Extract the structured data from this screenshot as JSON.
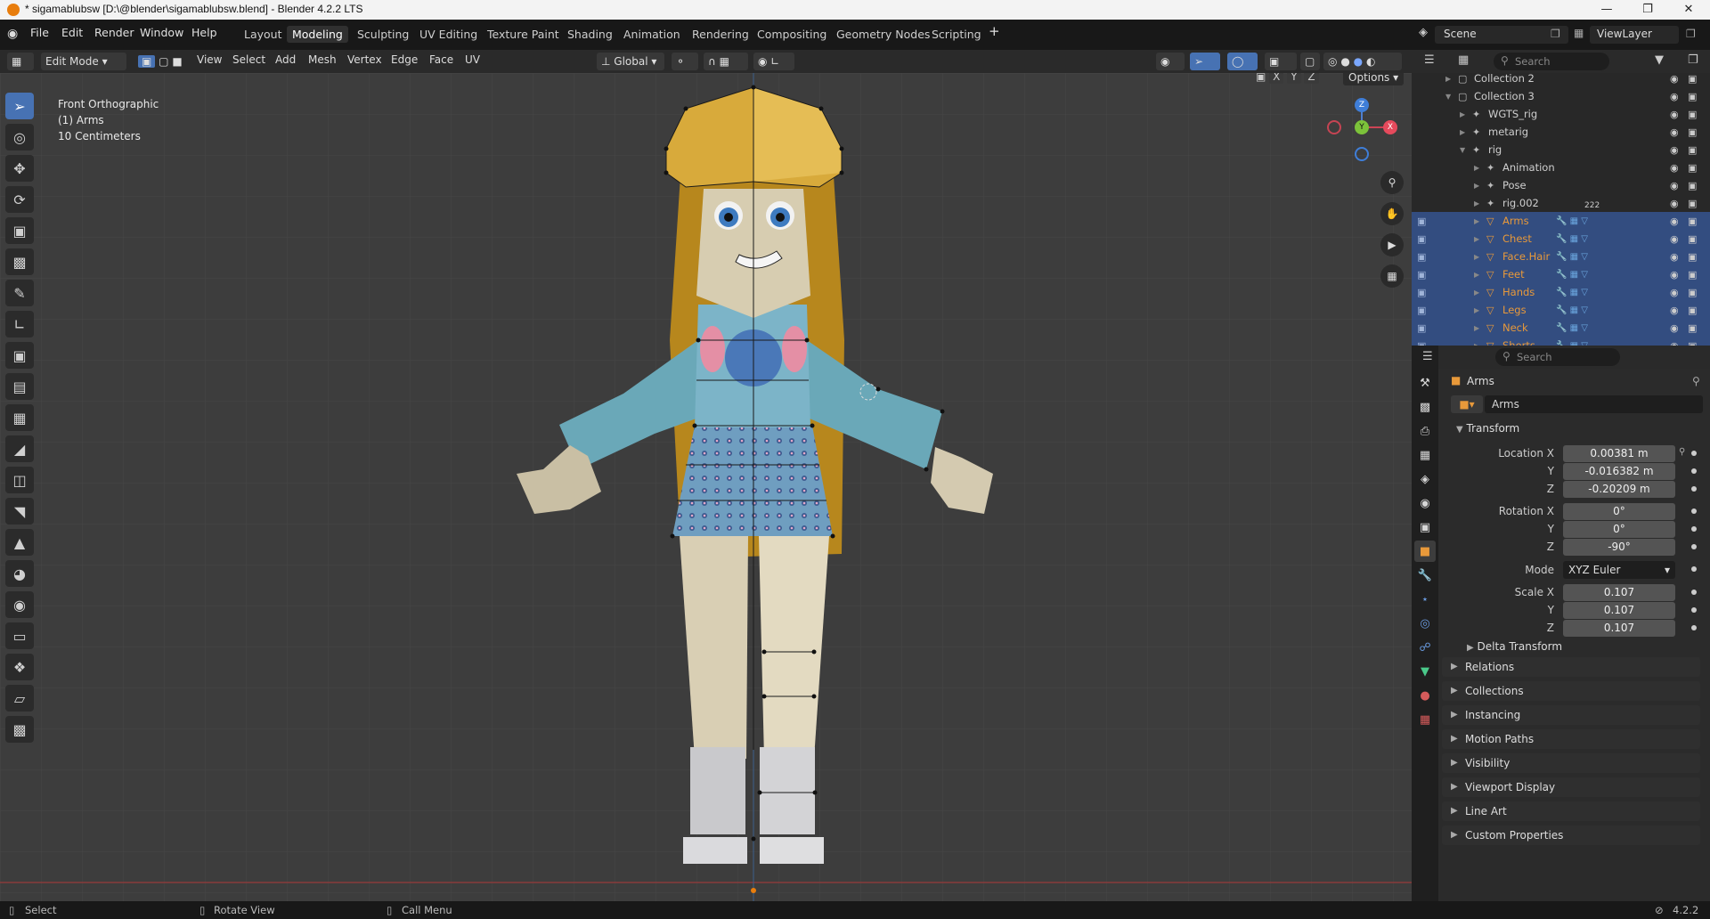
{
  "window": {
    "title": "* sigamablubsw [D:\\@blender\\sigamablubsw.blend] - Blender 4.2.2 LTS"
  },
  "menu": [
    "File",
    "Edit",
    "Render",
    "Window",
    "Help"
  ],
  "workspaces": [
    "Layout",
    "Modeling",
    "Sculpting",
    "UV Editing",
    "Texture Paint",
    "Shading",
    "Animation",
    "Rendering",
    "Compositing",
    "Geometry Nodes",
    "Scripting"
  ],
  "active_workspace": "Modeling",
  "scene": {
    "label": "Scene",
    "view_layer": "ViewLayer"
  },
  "viewport_header": {
    "mode": "Edit Mode",
    "menus": [
      "View",
      "Select",
      "Add",
      "Mesh",
      "Vertex",
      "Edge",
      "Face",
      "UV"
    ],
    "transform_orientation": "Global",
    "options_label": "Options",
    "axes": [
      "X",
      "Y",
      "Z"
    ]
  },
  "viewport_overlay": {
    "view_name": "Front Orthographic",
    "object": "(1) Arms",
    "scale": "10 Centimeters"
  },
  "gizmo": {
    "z": "Z",
    "y": "Y",
    "x": "X"
  },
  "outliner": {
    "search_placeholder": "Search",
    "rows": [
      {
        "label": "Collection 2",
        "indent": 2
      },
      {
        "label": "Collection 3",
        "indent": 2
      },
      {
        "label": "WGTS_rig",
        "indent": 3
      },
      {
        "label": "metarig",
        "indent": 3
      },
      {
        "label": "rig",
        "indent": 3
      },
      {
        "label": "Animation",
        "indent": 4
      },
      {
        "label": "Pose",
        "indent": 4
      },
      {
        "label": "rig.002",
        "indent": 4,
        "badge": "222"
      },
      {
        "label": "Arms",
        "indent": 4,
        "selected": true
      },
      {
        "label": "Chest",
        "indent": 4,
        "selected": true
      },
      {
        "label": "Face.Hair",
        "indent": 4,
        "selected": true
      },
      {
        "label": "Feet",
        "indent": 4,
        "selected": true
      },
      {
        "label": "Hands",
        "indent": 4,
        "selected": true
      },
      {
        "label": "Legs",
        "indent": 4,
        "selected": true
      },
      {
        "label": "Neck",
        "indent": 4,
        "selected": true
      },
      {
        "label": "Shorts",
        "indent": 4,
        "selected": true
      }
    ]
  },
  "properties": {
    "search_placeholder": "Search",
    "object_name": "Arms",
    "datablock_name": "Arms",
    "transform_label": "Transform",
    "location_label": "Location X",
    "location": [
      "0.00381 m",
      "-0.016382 m",
      "-0.20209 m"
    ],
    "rotation_label": "Rotation X",
    "rotation": [
      "0°",
      "0°",
      "-90°"
    ],
    "mode_label": "Mode",
    "rotation_mode": "XYZ Euler",
    "scale_label": "Scale X",
    "scale": [
      "0.107",
      "0.107",
      "0.107"
    ],
    "axis_y": "Y",
    "axis_z": "Z",
    "delta": "Delta Transform",
    "sections": [
      "Relations",
      "Collections",
      "Instancing",
      "Motion Paths",
      "Visibility",
      "Viewport Display",
      "Line Art",
      "Custom Properties"
    ]
  },
  "status": {
    "select": "Select",
    "rotate": "Rotate View",
    "menu": "Call Menu",
    "version": "4.2.2"
  }
}
